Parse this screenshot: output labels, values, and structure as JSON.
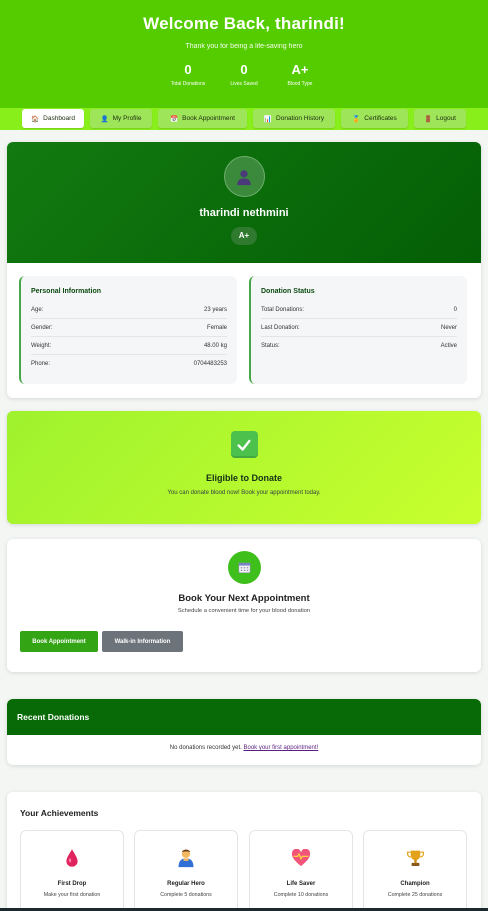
{
  "hero": {
    "title": "Welcome Back, tharindi!",
    "subtitle": "Thank you for being a life-saving hero",
    "stats": [
      {
        "value": "0",
        "label": "Total Donations"
      },
      {
        "value": "0",
        "label": "Lives Saved"
      },
      {
        "value": "A+",
        "label": "Blood Type"
      }
    ]
  },
  "nav": [
    {
      "icon": "home-icon",
      "glyph": "🏠",
      "label": "Dashboard"
    },
    {
      "icon": "user-icon",
      "glyph": "👤",
      "label": "My Profile"
    },
    {
      "icon": "calendar-icon",
      "glyph": "📅",
      "label": "Book Appointment"
    },
    {
      "icon": "chart-icon",
      "glyph": "📊",
      "label": "Donation History"
    },
    {
      "icon": "certificate-icon",
      "glyph": "🏅",
      "label": "Certificates"
    },
    {
      "icon": "logout-icon",
      "glyph": "🚪",
      "label": "Logout"
    }
  ],
  "profile": {
    "name": "tharindi nethmini",
    "blood_type": "A+",
    "personal": {
      "title": "Personal Information",
      "rows": [
        {
          "label": "Age:",
          "value": "23 years"
        },
        {
          "label": "Gender:",
          "value": "Female"
        },
        {
          "label": "Weight:",
          "value": "48.00 kg"
        },
        {
          "label": "Phone:",
          "value": "0704483253"
        }
      ]
    },
    "status": {
      "title": "Donation Status",
      "rows": [
        {
          "label": "Total Donations:",
          "value": "0"
        },
        {
          "label": "Last Donation:",
          "value": "Never"
        },
        {
          "label": "Status:",
          "value": "Active"
        }
      ]
    }
  },
  "eligible": {
    "title": "Eligible to Donate",
    "text": "You can donate blood now! Book your appointment today."
  },
  "booking": {
    "title": "Book Your Next Appointment",
    "text": "Schedule a convenient time for your blood donation",
    "primary_label": "Book Appointment",
    "secondary_label": "Walk-in Information"
  },
  "recent": {
    "title": "Recent Donations",
    "empty_text": "No donations recorded yet.",
    "link_text": "Book your first appointment!"
  },
  "achievements": {
    "title": "Your Achievements",
    "items": [
      {
        "icon": "blood-drop-icon",
        "name": "First Drop",
        "desc": "Make your first donation"
      },
      {
        "icon": "hero-icon",
        "name": "Regular Hero",
        "desc": "Complete 5 donations"
      },
      {
        "icon": "heart-icon",
        "name": "Life Saver",
        "desc": "Complete 10 donations"
      },
      {
        "icon": "trophy-icon",
        "name": "Champion",
        "desc": "Complete 25 donations"
      }
    ]
  },
  "colors": {
    "hero_green": "#55cc00",
    "nav_green": "#88ef1b",
    "dark_green": "#076a06",
    "accent_green": "#33a515",
    "gray_button": "#6c737a"
  }
}
